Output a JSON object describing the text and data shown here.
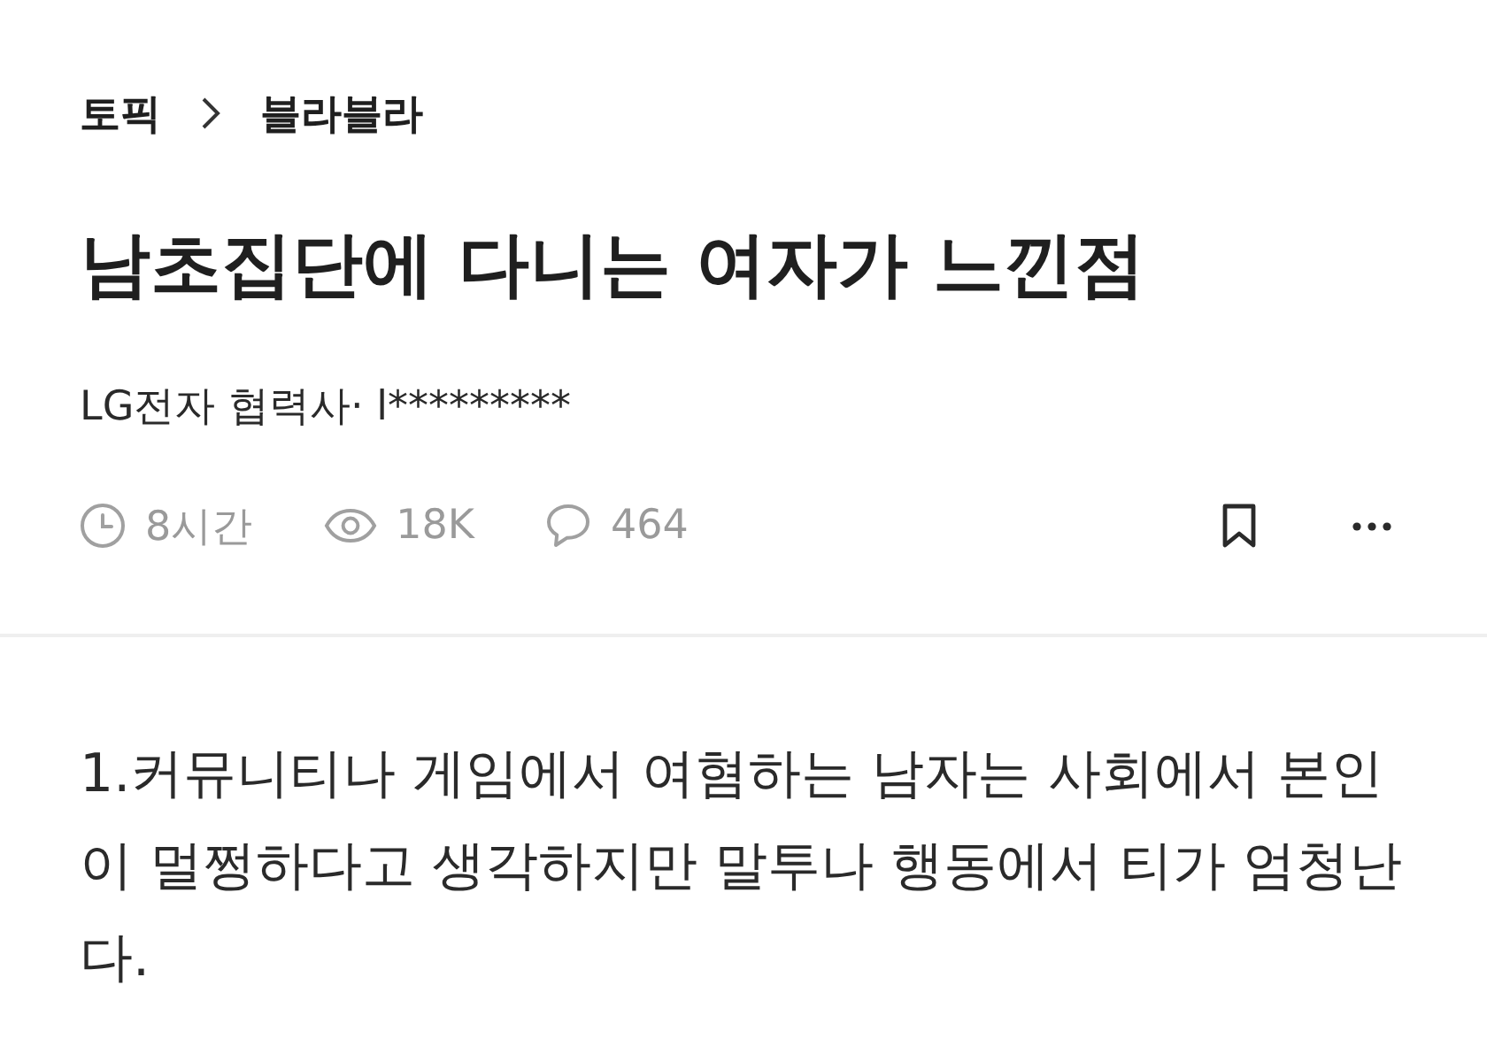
{
  "breadcrumb": {
    "items": [
      "토픽",
      "블라블라"
    ]
  },
  "post": {
    "title": "남초집단에 다니는 여자가 느낀점",
    "author": "LG전자 협력사· l*********",
    "stats": [
      {
        "kind": "time",
        "text": "8시간"
      },
      {
        "kind": "views",
        "text": "18K"
      },
      {
        "kind": "comments",
        "text": "464"
      }
    ],
    "body": "1.커뮤니티나 게임에서 여혐하는 남자는 사회에서 본인이 멀쩡하다고 생각하지만 말투나 행동에서 티가 엄청난다."
  }
}
